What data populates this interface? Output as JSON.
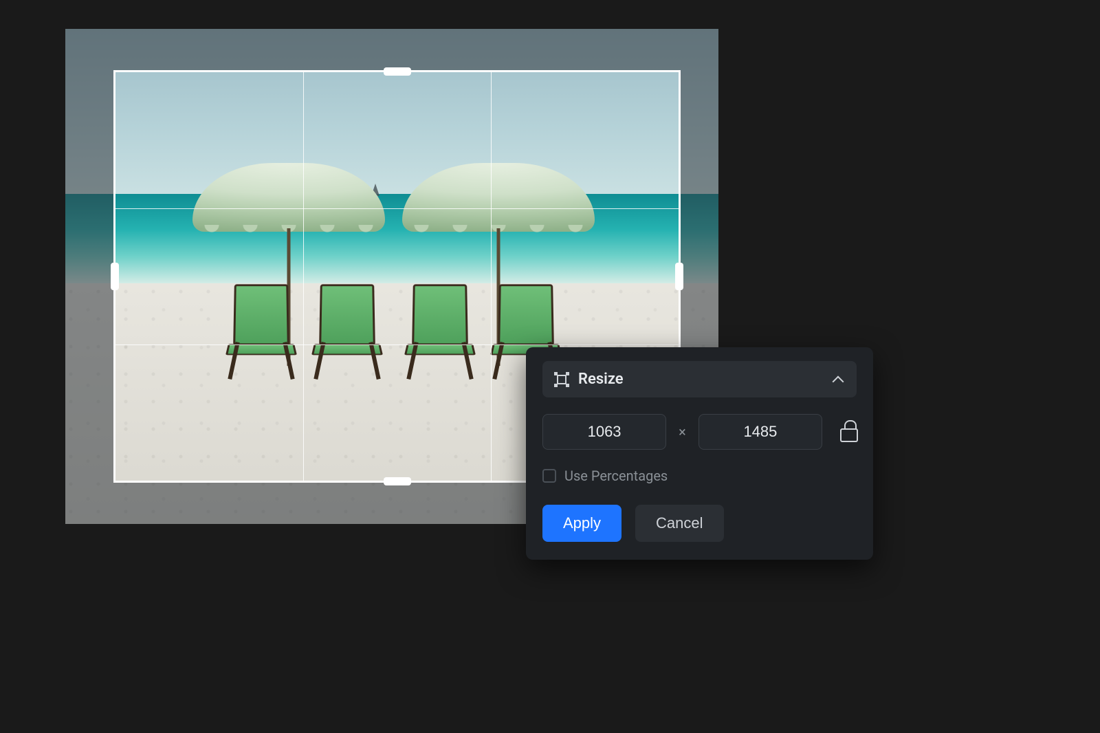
{
  "panel": {
    "title": "Resize",
    "width_value": "1063",
    "height_value": "1485",
    "separator": "×",
    "use_percentages_label": "Use Percentages",
    "use_percentages_checked": false,
    "lock_aspect": false,
    "apply_label": "Apply",
    "cancel_label": "Cancel"
  }
}
